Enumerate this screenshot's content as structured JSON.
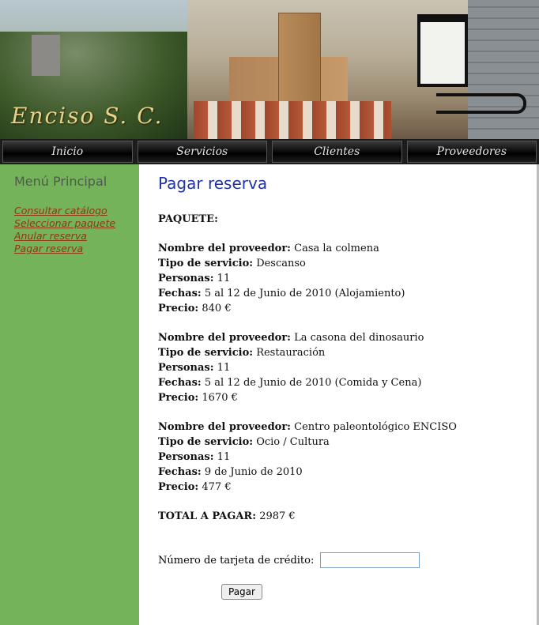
{
  "header": {
    "logo": "Enciso S. C."
  },
  "nav": [
    "Inicio",
    "Servicios",
    "Clientes",
    "Proveedores"
  ],
  "sidebar": {
    "title": "Menú Principal",
    "links": [
      "Consultar catálogo",
      "Seleccionar paquete",
      "Anular reserva",
      "Pagar reserva"
    ]
  },
  "main": {
    "title": "Pagar reserva",
    "section": "PAQUETE:",
    "labels": {
      "provider": "Nombre del proveedor:",
      "service": "Tipo de servicio:",
      "people": "Personas:",
      "dates": "Fechas:",
      "price": "Precio:"
    },
    "items": [
      {
        "provider": "Casa la colmena",
        "service": "Descanso",
        "people": "11",
        "dates": "5 al 12 de Junio de 2010 (Alojamiento)",
        "price": "840 €"
      },
      {
        "provider": "La casona del dinosaurio",
        "service": "Restauración",
        "people": "11",
        "dates": "5 al 12 de Junio de 2010 (Comida y Cena)",
        "price": "1670 €"
      },
      {
        "provider": "Centro paleontológico ENCISO",
        "service": "Ocio / Cultura",
        "people": "11",
        "dates": "9 de Junio de 2010",
        "price": "477 €"
      }
    ],
    "total_label": "TOTAL A PAGAR:",
    "total_value": "2987 €",
    "card_label": "Número de tarjeta de crédito:",
    "card_value": "",
    "pay_button": "Pagar"
  }
}
